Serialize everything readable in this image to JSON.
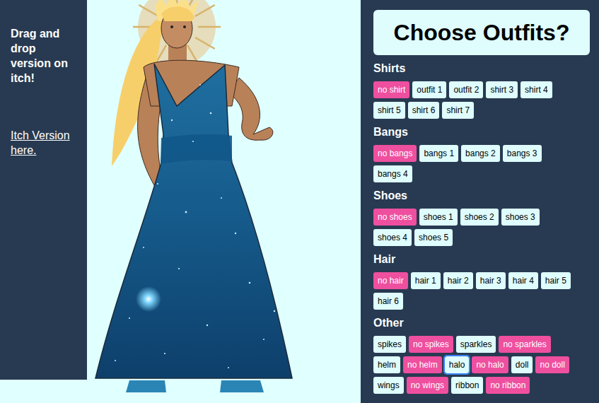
{
  "sidebar": {
    "text": "Drag and drop version on itch!",
    "link": "Itch Version here."
  },
  "header": {
    "title": "Choose Outfits?"
  },
  "sections": [
    {
      "title": "Shirts",
      "rows": [
        [
          {
            "label": "no shirt",
            "selected": true,
            "focused": false
          },
          {
            "label": "outfit 1",
            "selected": false,
            "focused": false
          },
          {
            "label": "outfit 2",
            "selected": false,
            "focused": false
          },
          {
            "label": "shirt 3",
            "selected": false,
            "focused": false
          },
          {
            "label": "shirt 4",
            "selected": false,
            "focused": false
          }
        ],
        [
          {
            "label": "shirt 5",
            "selected": false,
            "focused": false
          },
          {
            "label": "shirt 6",
            "selected": false,
            "focused": false
          },
          {
            "label": "shirt 7",
            "selected": false,
            "focused": false
          }
        ]
      ]
    },
    {
      "title": "Bangs",
      "rows": [
        [
          {
            "label": "no bangs",
            "selected": true,
            "focused": false
          },
          {
            "label": "bangs 1",
            "selected": false,
            "focused": false
          },
          {
            "label": "bangs 2",
            "selected": false,
            "focused": false
          },
          {
            "label": "bangs 3",
            "selected": false,
            "focused": false
          }
        ],
        [
          {
            "label": "bangs 4",
            "selected": false,
            "focused": false
          }
        ]
      ]
    },
    {
      "title": "Shoes",
      "rows": [
        [
          {
            "label": "no shoes",
            "selected": true,
            "focused": false
          },
          {
            "label": "shoes 1",
            "selected": false,
            "focused": false
          },
          {
            "label": "shoes 2",
            "selected": false,
            "focused": false
          },
          {
            "label": "shoes 3",
            "selected": false,
            "focused": false
          }
        ],
        [
          {
            "label": "shoes 4",
            "selected": false,
            "focused": false
          },
          {
            "label": "shoes 5",
            "selected": false,
            "focused": false
          }
        ]
      ]
    },
    {
      "title": "Hair",
      "rows": [
        [
          {
            "label": "no hair",
            "selected": true,
            "focused": false
          },
          {
            "label": "hair 1",
            "selected": false,
            "focused": false
          },
          {
            "label": "hair 2",
            "selected": false,
            "focused": false
          },
          {
            "label": "hair 3",
            "selected": false,
            "focused": false
          },
          {
            "label": "hair 4",
            "selected": false,
            "focused": false
          },
          {
            "label": "hair 5",
            "selected": false,
            "focused": false
          }
        ],
        [
          {
            "label": "hair 6",
            "selected": false,
            "focused": false
          }
        ]
      ]
    },
    {
      "title": "Other",
      "rows": [
        [
          {
            "label": "spikes",
            "selected": false,
            "focused": false
          },
          {
            "label": "no spikes",
            "selected": true,
            "focused": false
          },
          {
            "label": "sparkles",
            "selected": false,
            "focused": false
          },
          {
            "label": "no sparkles",
            "selected": true,
            "focused": false
          }
        ],
        [
          {
            "label": "helm",
            "selected": false,
            "focused": false
          },
          {
            "label": "no helm",
            "selected": true,
            "focused": false
          },
          {
            "label": "halo",
            "selected": false,
            "focused": true
          },
          {
            "label": "no halo",
            "selected": true,
            "focused": false
          },
          {
            "label": "doll",
            "selected": false,
            "focused": false
          },
          {
            "label": "no doll",
            "selected": true,
            "focused": false
          }
        ],
        [
          {
            "label": "wings",
            "selected": false,
            "focused": false
          },
          {
            "label": "no wings",
            "selected": true,
            "focused": false
          },
          {
            "label": "ribbon",
            "selected": false,
            "focused": false
          },
          {
            "label": "no ribbon",
            "selected": true,
            "focused": false
          }
        ]
      ]
    }
  ]
}
